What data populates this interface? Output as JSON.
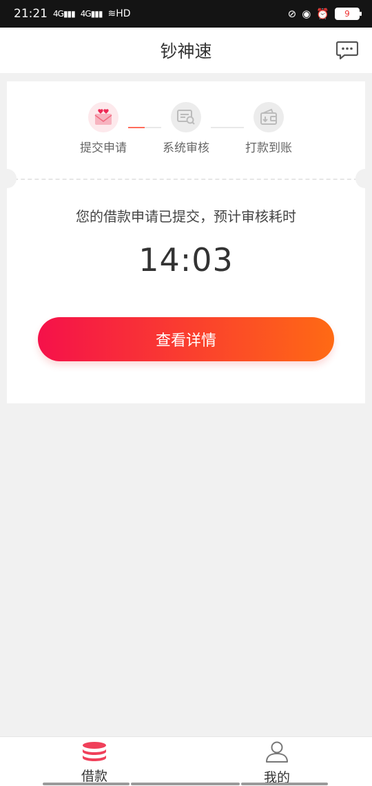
{
  "status_bar": {
    "time": "21:21",
    "signal_1": "4G",
    "signal_2": "4G",
    "wifi": "HD",
    "battery": "9"
  },
  "header": {
    "title": "钞神速"
  },
  "steps": [
    {
      "label": "提交申请",
      "icon": "envelope-heart-icon",
      "state": "active"
    },
    {
      "label": "系统审核",
      "icon": "document-search-icon",
      "state": "inactive"
    },
    {
      "label": "打款到账",
      "icon": "wallet-icon",
      "state": "inactive"
    }
  ],
  "message": "您的借款申请已提交，预计审核耗时",
  "countdown": "14:03",
  "detail_button": "查看详情",
  "bottom_nav": [
    {
      "label": "借款",
      "icon": "coins-stack-icon",
      "active": true
    },
    {
      "label": "我的",
      "icon": "user-icon",
      "active": false
    }
  ],
  "colors": {
    "accent_start": "#f5114a",
    "accent_end": "#ff6a14",
    "accent_pink": "#f0405a"
  }
}
